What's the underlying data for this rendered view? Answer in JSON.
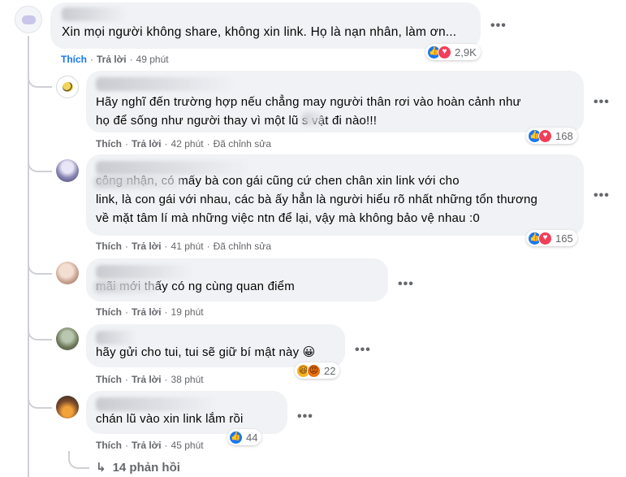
{
  "ui": {
    "like_label": "Thích",
    "reply_label": "Trả lời",
    "edited_label": "Đã chỉnh sửa",
    "more_label": "•••",
    "accent": "#1877f2",
    "bubble_bg": "#f0f2f5"
  },
  "comments": [
    {
      "name": "Y",
      "text": "Xin mọi người không share, không xin link. Họ là nạn nhân, làm ơn...",
      "time": "49 phút",
      "reactions": {
        "icons": [
          "like-icon",
          "love-icon"
        ],
        "count": "2,9K"
      }
    },
    {
      "name": "C",
      "text": "Hãy nghĩ đến trường hợp nếu chẳng may người thân rơi vào hoàn cảnh như\nhọ để sống như người thay vì một lũ s    vật đi nào!!!",
      "time": "42 phút",
      "edited": true,
      "reactions": {
        "icons": [
          "like-icon",
          "love-icon"
        ],
        "count": "168"
      }
    },
    {
      "name": "N",
      "text": "                     công nhận, có mấy bà con gái cũng cứ chen chân xin link với cho\nlink, là con gái với nhau, các bà ấy hẳn là người hiểu rõ nhất những tổn thương\nvề mặt tâm lí mà những việc ntn để lại, vậy mà không bảo vệ nhau :0",
      "time": "41 phút",
      "edited": true,
      "reactions": {
        "icons": [
          "like-icon",
          "love-icon"
        ],
        "count": "165"
      }
    },
    {
      "name": "",
      "text": "                  mãi mới thấy có ng cùng quan điểm",
      "time": "19 phút"
    },
    {
      "name": "",
      "text": "hãy gửi cho tui, tui sẽ giữ bí mật này 😀",
      "time": "38 phút",
      "reactions": {
        "icons": [
          "haha-icon",
          "angry-icon"
        ],
        "count": "22"
      }
    },
    {
      "name": "",
      "text": "chán lũ vào xin link lắm rồi",
      "time": "45 phút",
      "reactions": {
        "icons": [
          "like-icon"
        ],
        "count": "44"
      }
    }
  ],
  "view_replies": {
    "label": "14 phản hồi"
  }
}
